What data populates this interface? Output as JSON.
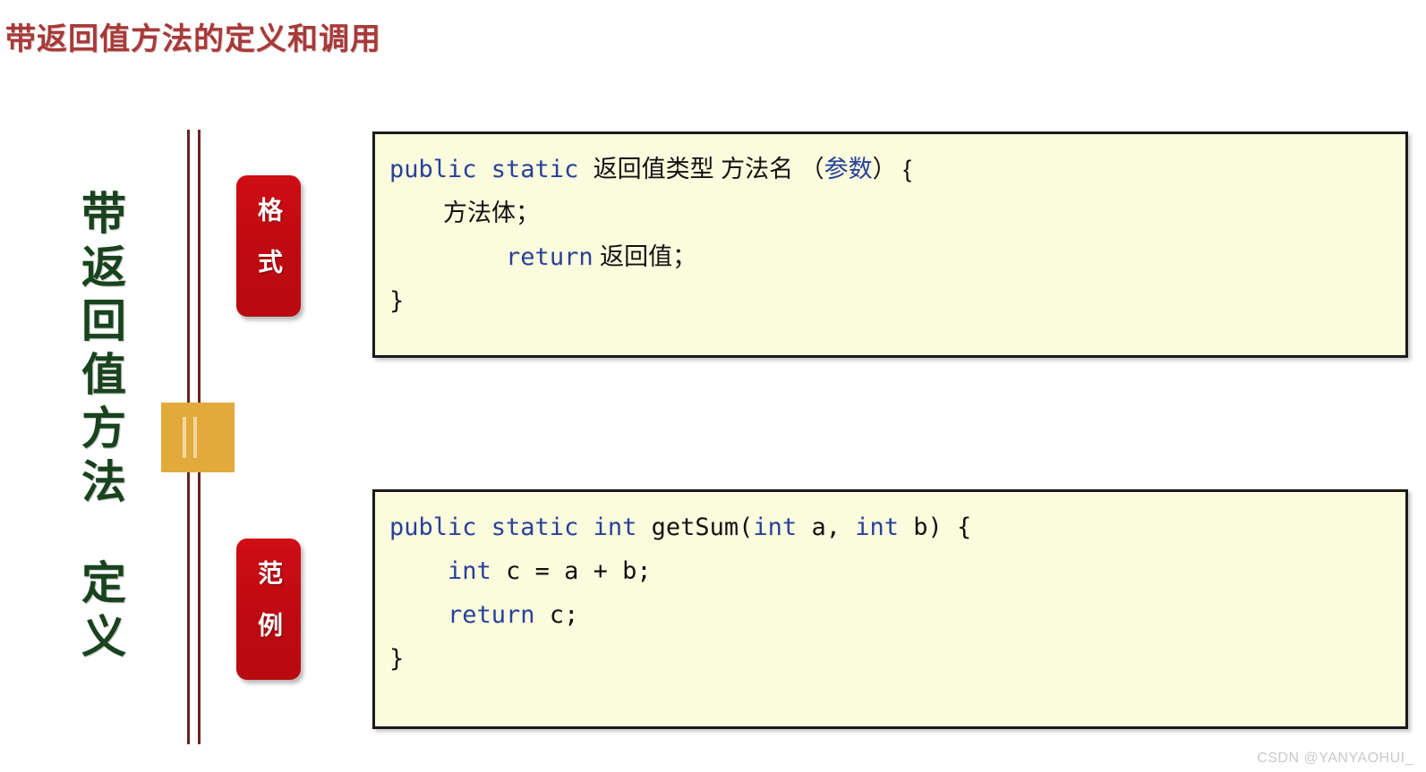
{
  "slide": {
    "title": "带返回值方法的定义和调用",
    "title_color": "#a73a39",
    "background": "#ffffff"
  },
  "left_rail": {
    "vertical_label_main": "带返回值方法",
    "vertical_label_sub": "定义",
    "label_color": "#18431d",
    "rule_color": "#6b2222",
    "ribbon_color": "#e2aa3c",
    "ribbon_icon": "bookmark-ribbon-icon"
  },
  "badges": [
    {
      "id": "format",
      "label": "格式",
      "background": "#c00a11",
      "text_color": "#ffffff"
    },
    {
      "id": "example",
      "label": "范例",
      "background": "#c00a11",
      "text_color": "#ffffff"
    }
  ],
  "code_panels": [
    {
      "id": "format",
      "background": "#fbfbdd",
      "border_color": "#1a1a1a",
      "keyword_color": "#27409a",
      "text_color": "#111111",
      "lines": [
        {
          "id": "l1",
          "tokens": [
            {
              "t": "public static ",
              "k": true
            },
            {
              "t": "返回值类型 方法名 （",
              "k": false
            },
            {
              "t": "参数",
              "k": true
            },
            {
              "t": "） {",
              "k": false
            }
          ]
        },
        {
          "id": "l2",
          "tokens": [
            {
              "t": "        方法体；",
              "k": false
            }
          ]
        },
        {
          "id": "l3",
          "tokens": [
            {
              "t": "        ",
              "k": false
            },
            {
              "t": "return",
              "k": true
            },
            {
              "t": " 返回值；",
              "k": false
            }
          ]
        },
        {
          "id": "l4",
          "tokens": [
            {
              "t": "}",
              "k": false
            }
          ]
        }
      ]
    },
    {
      "id": "example",
      "background": "#fbfbdd",
      "border_color": "#1a1a1a",
      "keyword_color": "#27409a",
      "text_color": "#111111",
      "lines": [
        {
          "id": "l1",
          "tokens": [
            {
              "t": "public static int ",
              "k": true
            },
            {
              "t": "getSum(",
              "k": false
            },
            {
              "t": "int",
              "k": true
            },
            {
              "t": " a, ",
              "k": false
            },
            {
              "t": "int",
              "k": true
            },
            {
              "t": " b) {",
              "k": false
            }
          ]
        },
        {
          "id": "l2",
          "tokens": [
            {
              "t": "    ",
              "k": false
            },
            {
              "t": "int",
              "k": true
            },
            {
              "t": " c = a + b;",
              "k": false
            }
          ]
        },
        {
          "id": "l3",
          "tokens": [
            {
              "t": "    ",
              "k": false
            },
            {
              "t": "return",
              "k": true
            },
            {
              "t": " c;",
              "k": false
            }
          ]
        },
        {
          "id": "l4",
          "tokens": [
            {
              "t": "}",
              "k": false
            }
          ]
        }
      ]
    }
  ],
  "watermark": {
    "text": "CSDN @YANYAOHUI_",
    "color": "#c9c9c9"
  }
}
